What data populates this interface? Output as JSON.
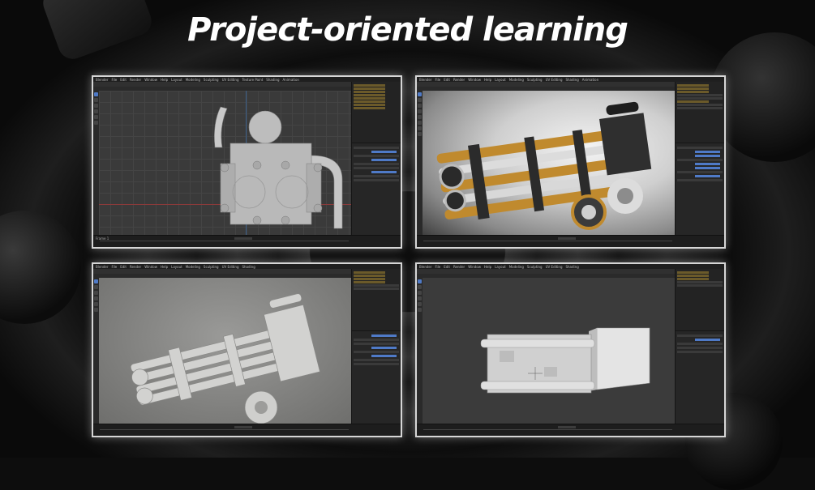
{
  "title": "Project-oriented learning",
  "windows": [
    {
      "id": "w1",
      "app": "Blender",
      "menu": [
        "File",
        "Edit",
        "Render",
        "Window",
        "Help",
        "Layout",
        "Modeling",
        "Sculpting",
        "UV Editing",
        "Texture Paint",
        "Shading",
        "Animation"
      ],
      "view": "orthographic-front-model",
      "status": [
        "Frame 1",
        "Objects"
      ]
    },
    {
      "id": "w2",
      "app": "Blender",
      "menu": [
        "File",
        "Edit",
        "Render",
        "Window",
        "Help",
        "Layout",
        "Modeling",
        "Sculpting",
        "UV Editing",
        "Shading",
        "Animation"
      ],
      "view": "rendered-minigun"
    },
    {
      "id": "w3",
      "app": "Blender",
      "menu": [
        "File",
        "Edit",
        "Render",
        "Window",
        "Help",
        "Layout",
        "Modeling",
        "Sculpting",
        "UV Editing",
        "Shading"
      ],
      "view": "solid-minigun"
    },
    {
      "id": "w4",
      "app": "Blender",
      "menu": [
        "File",
        "Edit",
        "Render",
        "Window",
        "Help",
        "Layout",
        "Modeling",
        "Sculpting",
        "UV Editing",
        "Shading"
      ],
      "view": "blockout-model"
    }
  ],
  "colors": {
    "accent": "#4f7ac7",
    "brass": "#c08a2e",
    "frame_border": "#d6d6d6"
  }
}
